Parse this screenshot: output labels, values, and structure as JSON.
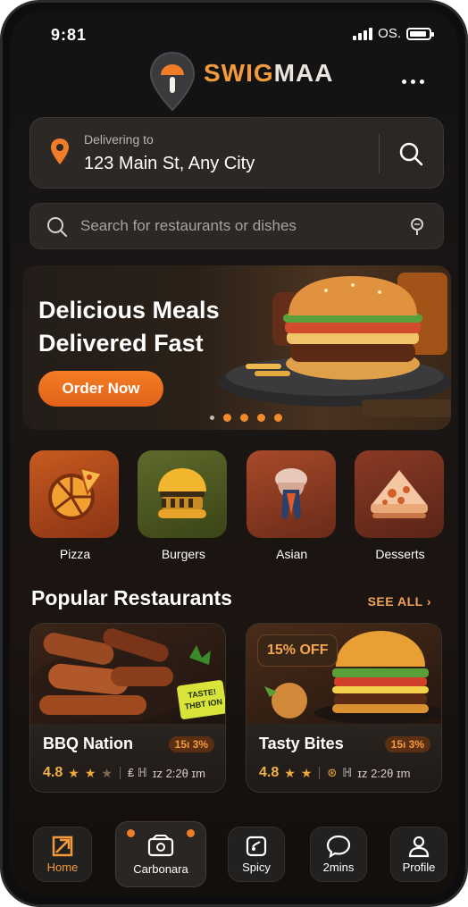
{
  "status": {
    "time": "9:81",
    "carrier": "OS."
  },
  "brand": {
    "part1": "SWIG",
    "part2": "MAA"
  },
  "delivery": {
    "label": "Delivering to",
    "address": "123 Main St, Any City"
  },
  "search": {
    "placeholder": "Search for restaurants or dishes"
  },
  "banner": {
    "line1": "Delicious Meals",
    "line2": "Delivered Fast",
    "cta": "Order Now"
  },
  "categories": [
    {
      "label": "Pizza",
      "icon": "pizza-icon"
    },
    {
      "label": "Burgers",
      "icon": "burger-icon"
    },
    {
      "label": "Asian",
      "icon": "asian-icon"
    },
    {
      "label": "Desserts",
      "icon": "dessert-icon"
    }
  ],
  "section": {
    "title": "Popular Restaurants",
    "see_all": "SEE ALL ›"
  },
  "restaurants": [
    {
      "name": "BBQ Nation",
      "discount": "15ı 3%",
      "rating": "4.8",
      "meta1": "₤ ℍ",
      "meta2": "ɪᴢ 2:2θ ɪm",
      "tag": "TASTE! THBT ION"
    },
    {
      "name": "Tasty Bites",
      "discount": "15ı 3%",
      "rating": "4.8",
      "meta1": "ℍ",
      "meta2": "ɪᴢ 2:2θ ɪm",
      "badge": "15% OFF"
    }
  ],
  "nav": [
    {
      "label": "Home",
      "icon": "home-icon"
    },
    {
      "label": "Carbonara",
      "icon": "wallet-icon"
    },
    {
      "label": "Spicy",
      "icon": "spicy-icon"
    },
    {
      "label": "2mins",
      "icon": "chat-icon"
    },
    {
      "label": "Profile",
      "icon": "profile-icon"
    }
  ],
  "colors": {
    "accent": "#F07C2A",
    "background": "#141210",
    "card": "#2A2624"
  }
}
